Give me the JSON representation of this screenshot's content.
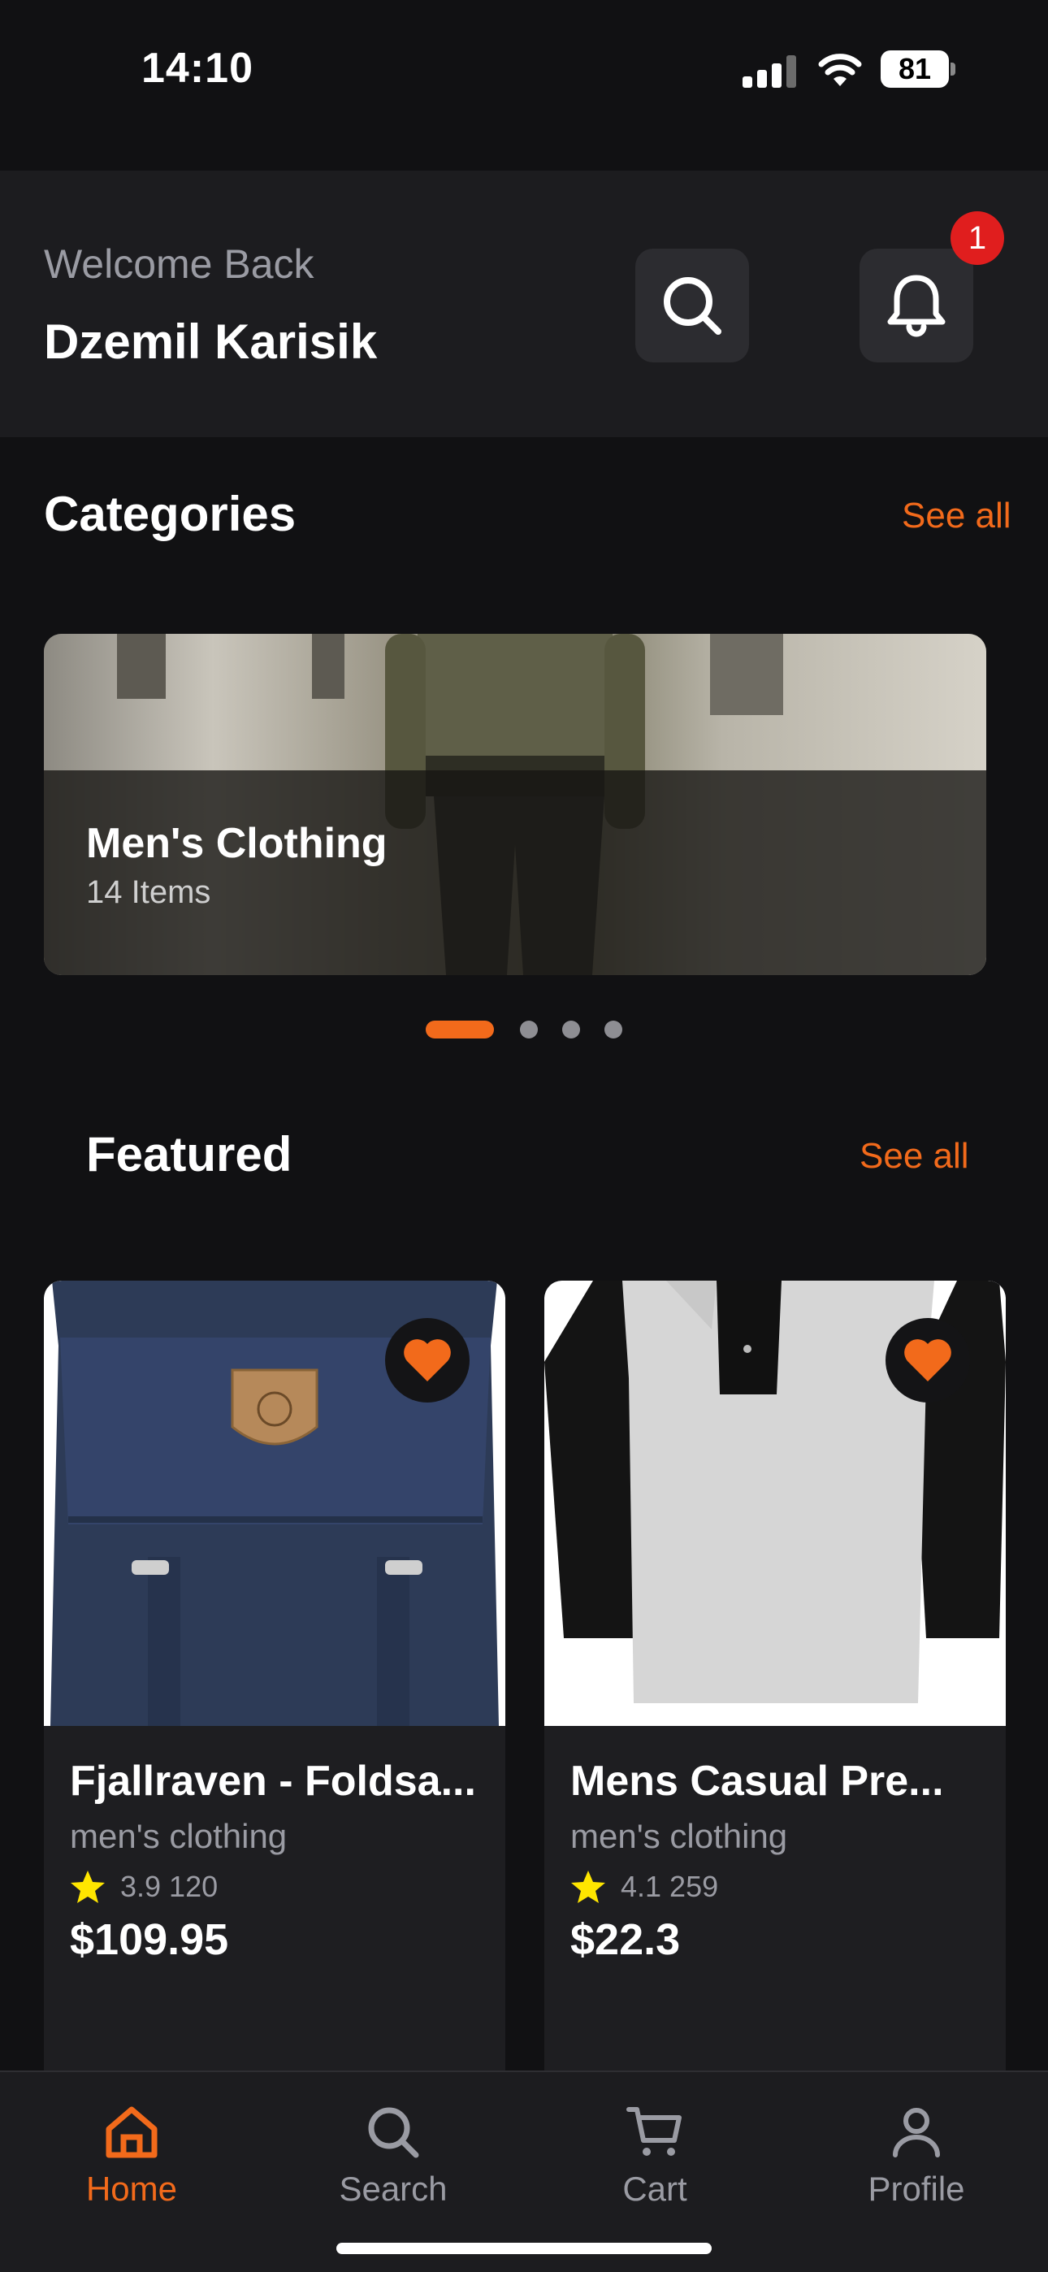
{
  "status_bar": {
    "time": "14:10",
    "battery": "81"
  },
  "header": {
    "welcome": "Welcome Back",
    "username": "Dzemil Karisik",
    "notification_count": "1",
    "search_icon": "search-icon",
    "bell_icon": "bell-icon"
  },
  "categories": {
    "title": "Categories",
    "see_all": "See all",
    "items": [
      {
        "name": "Men's Clothing",
        "count": "14 Items"
      }
    ],
    "pager": {
      "total": 4,
      "active": 1
    }
  },
  "featured": {
    "title": "Featured",
    "see_all": "See all",
    "products": [
      {
        "title": "Fjallraven - Foldsa...",
        "category": "men's clothing",
        "rating": "3.9 120",
        "price": "$109.95",
        "favorite": true
      },
      {
        "title": "Mens Casual Pre...",
        "category": "men's clothing",
        "rating": "4.1 259",
        "price": "$22.3",
        "favorite": true
      }
    ]
  },
  "bottom_nav": {
    "items": [
      {
        "label": "Home",
        "icon": "home-icon",
        "active": true
      },
      {
        "label": "Search",
        "icon": "search-icon",
        "active": false
      },
      {
        "label": "Cart",
        "icon": "cart-icon",
        "active": false
      },
      {
        "label": "Profile",
        "icon": "profile-icon",
        "active": false
      }
    ]
  },
  "colors": {
    "accent": "#f26a1b",
    "background": "#111113",
    "surface": "#1c1c1f",
    "badge": "#e01e1e",
    "star": "#ffe600"
  }
}
